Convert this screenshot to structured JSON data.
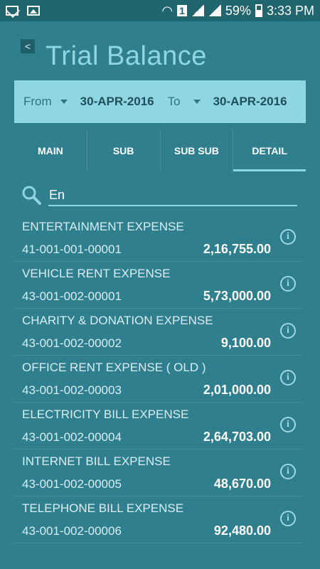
{
  "status_bar": {
    "battery_percent": "59%",
    "sim_badge": "1",
    "time": "3:33 PM"
  },
  "header": {
    "back_label": "<",
    "title": "Trial Balance"
  },
  "date_filter": {
    "from_label": "From",
    "from_value": "30-APR-2016",
    "to_label": "To",
    "to_value": "30-APR-2016"
  },
  "tabs": [
    {
      "label": "MAIN"
    },
    {
      "label": "SUB"
    },
    {
      "label": "SUB SUB"
    },
    {
      "label": "DETAIL"
    }
  ],
  "search": {
    "value": "En"
  },
  "accounts": [
    {
      "name": "ENTERTAINMENT EXPENSE",
      "code": "41-001-001-00001",
      "amount": "2,16,755.00"
    },
    {
      "name": "VEHICLE RENT EXPENSE",
      "code": "43-001-002-00001",
      "amount": "5,73,000.00"
    },
    {
      "name": "CHARITY & DONATION EXPENSE",
      "code": "43-001-002-00002",
      "amount": "9,100.00"
    },
    {
      "name": "OFFICE RENT EXPENSE ( OLD )",
      "code": "43-001-002-00003",
      "amount": "2,01,000.00"
    },
    {
      "name": "ELECTRICITY BILL EXPENSE",
      "code": "43-001-002-00004",
      "amount": "2,64,703.00"
    },
    {
      "name": "INTERNET BILL EXPENSE",
      "code": "43-001-002-00005",
      "amount": "48,670.00"
    },
    {
      "name": "TELEPHONE BILL EXPENSE",
      "code": "43-001-002-00006",
      "amount": "92,480.00"
    }
  ],
  "info_icon_glyph": "i"
}
